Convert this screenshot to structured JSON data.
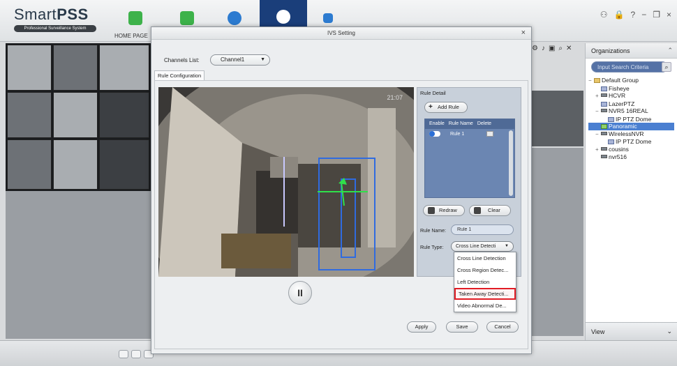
{
  "app": {
    "name_regular": "Smart",
    "name_bold": "PSS",
    "tagline": "Professional Surveillance System",
    "home_tab_label": "HOME PAGE",
    "window_controls": [
      "⚇",
      "🔒",
      "?",
      "−",
      "❐",
      "×"
    ]
  },
  "dialog": {
    "title": "IVS Setting",
    "close": "×",
    "channel_label": "Channels List:",
    "channel_value": "Channel1",
    "tab_label": "Rule Configuration",
    "timestamp": "21:07",
    "pause_symbol": "II"
  },
  "rule_detail": {
    "title": "Rule Detail",
    "add_rule": "Add Rule",
    "columns": [
      "Enable",
      "Rule Name",
      "Delete"
    ],
    "rows": [
      {
        "name": "Rule 1",
        "enabled": true
      }
    ],
    "redraw": "Redraw",
    "clear": "Clear",
    "rule_name_label": "Rule Name:",
    "rule_name_value": "Rule 1",
    "rule_type_label": "Rule Type:",
    "rule_type_value": "Cross Line Detecti"
  },
  "rule_type_options": [
    {
      "label": "Cross Line Detection",
      "highlighted": false
    },
    {
      "label": "Cross Region Detec...",
      "highlighted": false
    },
    {
      "label": "Left Detection",
      "highlighted": false
    },
    {
      "label": "Taken Away Detecti...",
      "highlighted": true
    },
    {
      "label": "Video Abnormal De...",
      "highlighted": false
    }
  ],
  "footer_buttons": {
    "apply": "Apply",
    "save": "Save",
    "cancel": "Cancel"
  },
  "organizations": {
    "title": "Organizations",
    "search_placeholder": "Input Search Criteria",
    "tree": [
      {
        "label": "Default Group",
        "depth": 0,
        "toggle": "−",
        "icon": "folder"
      },
      {
        "label": "Fisheye",
        "depth": 1,
        "toggle": "",
        "icon": "cam"
      },
      {
        "label": "HCVR",
        "depth": 1,
        "toggle": "+",
        "icon": "dev"
      },
      {
        "label": "LazerPTZ",
        "depth": 1,
        "toggle": "",
        "icon": "cam"
      },
      {
        "label": "NVR5 16REAL",
        "depth": 1,
        "toggle": "−",
        "icon": "dev"
      },
      {
        "label": "IP PTZ Dome",
        "depth": 2,
        "toggle": "",
        "icon": "cam"
      },
      {
        "label": "Panoramic",
        "depth": 1,
        "toggle": "",
        "icon": "camg",
        "selected": true
      },
      {
        "label": "WirelessNVR",
        "depth": 1,
        "toggle": "−",
        "icon": "dev"
      },
      {
        "label": "IP PTZ Dome",
        "depth": 2,
        "toggle": "",
        "icon": "cam"
      },
      {
        "label": "cousins",
        "depth": 1,
        "toggle": "+",
        "icon": "dev"
      },
      {
        "label": "nvr516",
        "depth": 1,
        "toggle": "",
        "icon": "dev"
      }
    ],
    "footer": "View",
    "footer_caret": "⌄"
  },
  "colors": {
    "active_tab": "#1a3e7a",
    "highlight_red": "#e11c24",
    "selected_node": "#4a7fd1",
    "rule_table": "#6b86b2"
  }
}
